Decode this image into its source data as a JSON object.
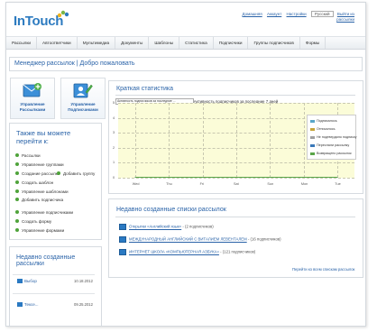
{
  "app": {
    "logo": "InTouch"
  },
  "toplinks": {
    "help": "Домашняя",
    "account": "Аккаунт",
    "settings": "Настройки",
    "language": "Русский",
    "logout": "Выйти из",
    "logout2": "рассылки"
  },
  "nav": [
    "Рассылки",
    "Автоответчики",
    "Мультимедиа",
    "Документы",
    "Шаблоны",
    "Статистика",
    "Подписчики",
    "Группы подписчиков",
    "Формы"
  ],
  "page_title": "Менеджер рассылок | Добро пожаловать",
  "tiles": [
    {
      "label1": "Управление",
      "label2": "Рассылками"
    },
    {
      "label1": "Управление",
      "label2": "Подписчиками"
    }
  ],
  "quick_links": {
    "title1": "Также вы можете",
    "title2": "перейти к:",
    "items": [
      "Рассылки",
      "Управление группами",
      "Создание рассылки",
      "Добавить группу",
      "Создать шаблон",
      "Управление шаблонами",
      "Добавить подписчика",
      "Управление подписчиками",
      "Создать форму",
      "Управление формами"
    ]
  },
  "recent_mail": {
    "title1": "Недавно созданные",
    "title2": "рассылки",
    "items": [
      {
        "name": "Выбор",
        "date": "10.18.2012"
      },
      {
        "name": "Тексе...",
        "date": "09.25.2012"
      }
    ]
  },
  "stats": {
    "title": "Краткая статистика",
    "select_value": "Активность подписчиков за последние ...",
    "chart_title": "Активность подписчиков за последние 7 дней"
  },
  "chart_data": {
    "type": "line",
    "title": "Активность подписчиков за последние 7 дней",
    "categories": [
      "Wed",
      "Thu",
      "Fri",
      "Sat",
      "Sun",
      "Mon",
      "Tue"
    ],
    "yticks": [
      "5",
      "4",
      "3",
      "2",
      "1",
      "0"
    ],
    "ylim": [
      0,
      5
    ],
    "series": [
      {
        "name": "Подписалось",
        "color": "#59a6c8",
        "values": [
          0,
          0,
          0,
          0,
          0,
          0,
          0
        ]
      },
      {
        "name": "Отписалось",
        "color": "#c6a53b",
        "values": [
          0,
          0,
          0,
          0,
          0,
          0,
          0
        ]
      },
      {
        "name": "Не подтвердило подписку",
        "color": "#a0a0a0",
        "values": [
          0,
          0,
          0,
          0,
          0,
          0,
          0
        ]
      },
      {
        "name": "Переслали рассылку",
        "color": "#3a78b8",
        "values": [
          0,
          0,
          0,
          0,
          0,
          0,
          0
        ]
      },
      {
        "name": "Возвращено рассылок",
        "color": "#5aa549",
        "values": [
          0,
          0,
          0,
          0,
          0,
          0,
          0
        ]
      }
    ],
    "legend_position": "right",
    "grid": true
  },
  "lists": {
    "title": "Недавно созданные списки рассылок",
    "items": [
      {
        "name": "Открытки «Английский язык»",
        "count": "- (2 подписчиков)"
      },
      {
        "name": "МЕЖДУНАРОДНЫЙ АНГЛИЙСКИЙ С ВИТАЛИЕМ ЛЕВЕНТАЛЕМ",
        "count": "- (16 подписчиков)"
      },
      {
        "name": "ИНТЕРНЕТ ШКОЛА «КОМПЬЮТЕРНАЯ АЗБУКА»",
        "count": "- (121 подписчиков)"
      }
    ],
    "goto_all": "Перейти ко всем спискам рассылок"
  }
}
